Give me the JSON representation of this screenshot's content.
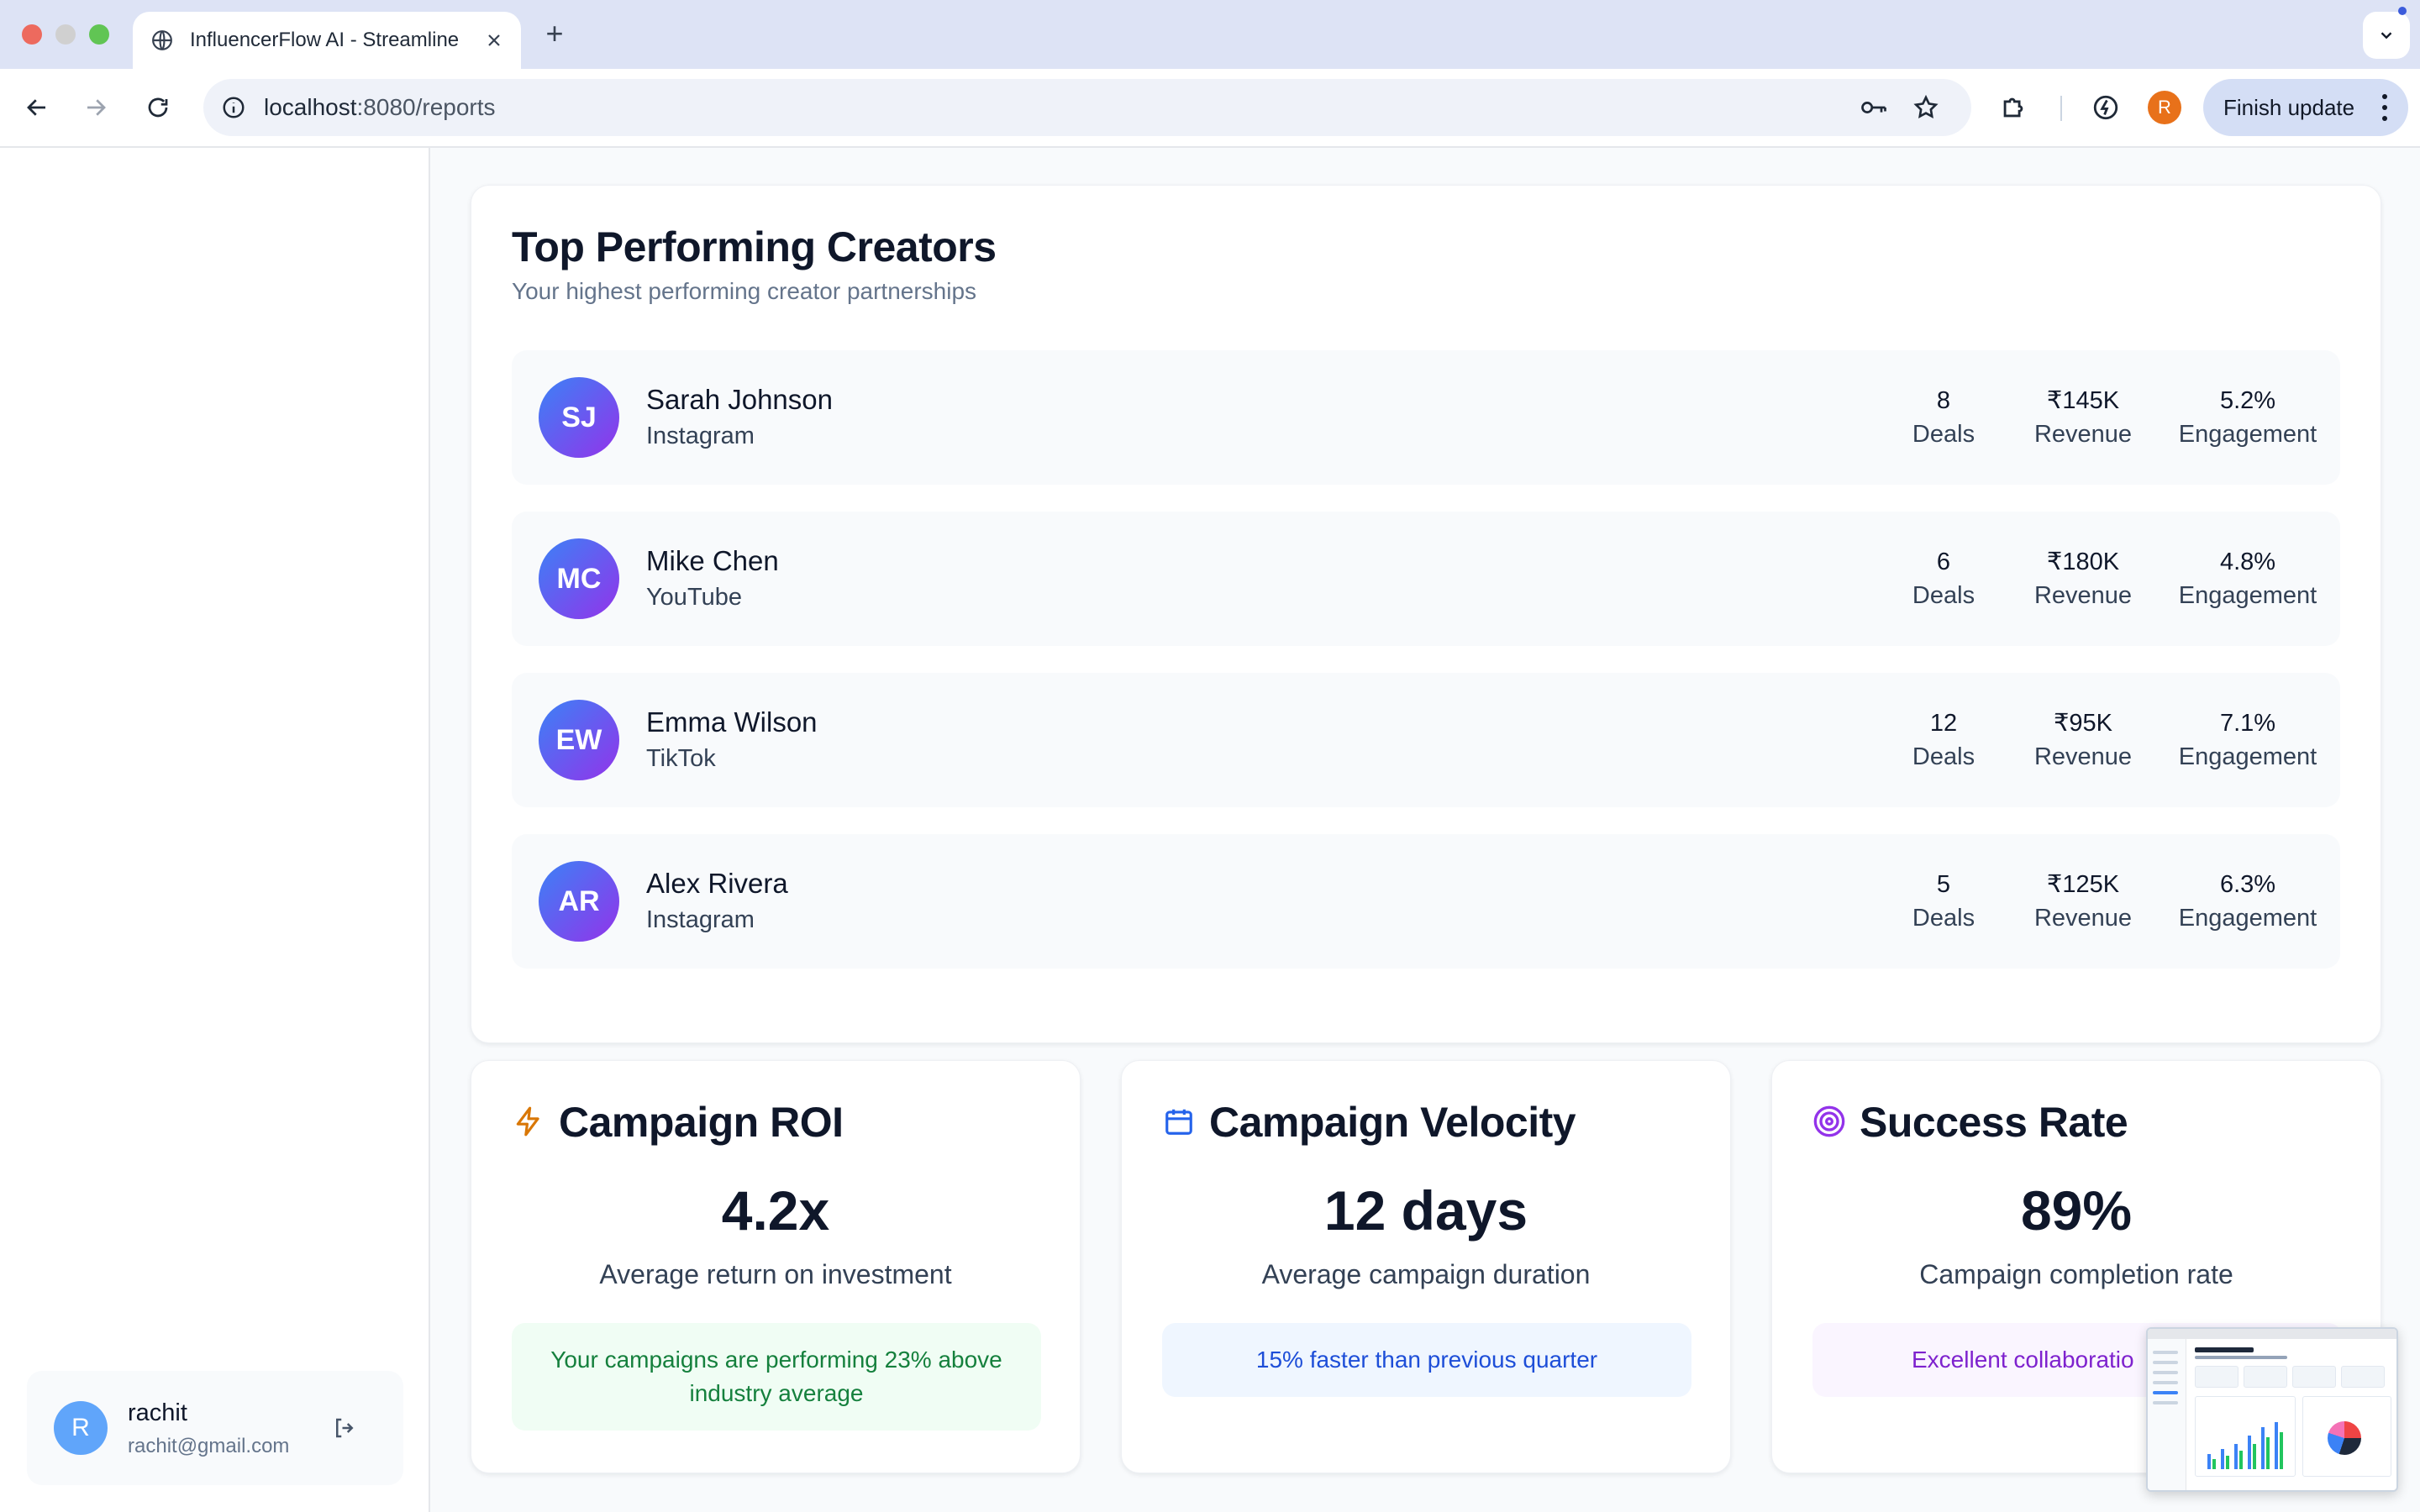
{
  "browser": {
    "tab_title": "InfluencerFlow AI - Streamline",
    "new_tab": "+",
    "url_host": "localhost",
    "url_rest": ":8080/reports",
    "profile_initial": "R",
    "finish_update": "Finish update",
    "icons": [
      "globe-icon",
      "close-icon",
      "back-icon",
      "forward-icon",
      "reload-icon",
      "info-icon",
      "key-icon",
      "star-icon",
      "extensions-icon",
      "performance-icon",
      "more-icon",
      "chevron-down-icon"
    ]
  },
  "sidebar": {
    "user": {
      "initial": "R",
      "name": "rachit",
      "email": "rachit@gmail.com"
    }
  },
  "top_creators": {
    "title": "Top Performing Creators",
    "subtitle": "Your highest performing creator partnerships",
    "creators": [
      {
        "initials": "SJ",
        "name": "Sarah Johnson",
        "platform": "Instagram",
        "deals": "8",
        "deals_label": "Deals",
        "revenue": "₹145K",
        "revenue_label": "Revenue",
        "engagement": "5.2%",
        "engagement_label": "Engagement"
      },
      {
        "initials": "MC",
        "name": "Mike Chen",
        "platform": "YouTube",
        "deals": "6",
        "deals_label": "Deals",
        "revenue": "₹180K",
        "revenue_label": "Revenue",
        "engagement": "4.8%",
        "engagement_label": "Engagement"
      },
      {
        "initials": "EW",
        "name": "Emma Wilson",
        "platform": "TikTok",
        "deals": "12",
        "deals_label": "Deals",
        "revenue": "₹95K",
        "revenue_label": "Revenue",
        "engagement": "7.1%",
        "engagement_label": "Engagement"
      },
      {
        "initials": "AR",
        "name": "Alex Rivera",
        "platform": "Instagram",
        "deals": "5",
        "deals_label": "Deals",
        "revenue": "₹125K",
        "revenue_label": "Revenue",
        "engagement": "6.3%",
        "engagement_label": "Engagement"
      }
    ]
  },
  "metrics": {
    "roi": {
      "icon": "lightning-icon",
      "title": "Campaign ROI",
      "value": "4.2x",
      "description": "Average return on investment",
      "note": "Your campaigns are performing 23% above industry average",
      "accent": "#d97706"
    },
    "velocity": {
      "icon": "calendar-icon",
      "title": "Campaign Velocity",
      "value": "12 days",
      "description": "Average campaign duration",
      "note": "15% faster than previous quarter",
      "accent": "#2563eb"
    },
    "success": {
      "icon": "target-icon",
      "title": "Success Rate",
      "value": "89%",
      "description": "Campaign completion rate",
      "note": "Excellent collaboratio",
      "accent": "#9333ea"
    }
  },
  "colors": {
    "avatar_gradient_start": "#3b82f6",
    "avatar_gradient_end": "#9333ea",
    "green_note_bg": "#f0fdf4",
    "blue_note_bg": "#eff6ff",
    "purple_note_bg": "#faf5ff"
  }
}
